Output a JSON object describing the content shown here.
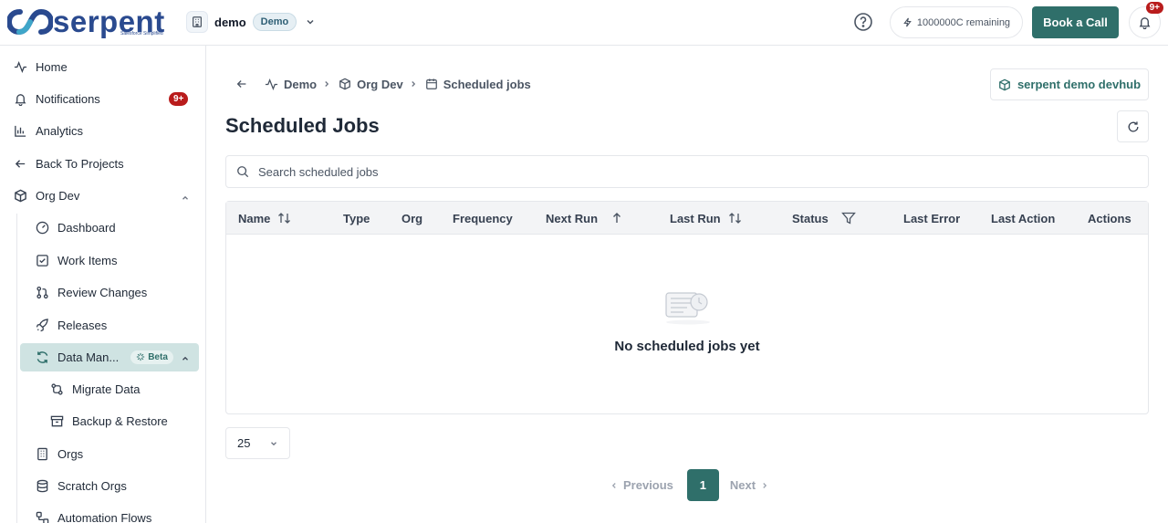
{
  "header": {
    "logo_text": "serpent",
    "logo_tagline": "Salesforce Simplified",
    "workspace_name": "demo",
    "workspace_badge": "Demo",
    "credits_text": "1000000C remaining",
    "book_call_label": "Book a Call",
    "notifications_badge": "9+"
  },
  "sidebar": {
    "home": "Home",
    "notifications": "Notifications",
    "notifications_badge": "9+",
    "analytics": "Analytics",
    "back_to_projects": "Back To Projects",
    "org_dev": "Org Dev",
    "dashboard": "Dashboard",
    "work_items": "Work Items",
    "review_changes": "Review Changes",
    "releases": "Releases",
    "data_management": "Data Man...",
    "beta_badge": "Beta",
    "migrate_data": "Migrate Data",
    "backup_restore": "Backup & Restore",
    "orgs": "Orgs",
    "scratch_orgs": "Scratch Orgs",
    "automation_flows": "Automation Flows"
  },
  "breadcrumb": {
    "demo": "Demo",
    "org_dev": "Org Dev",
    "current": "Scheduled jobs"
  },
  "devhub_label": "serpent demo devhub",
  "page_title": "Scheduled Jobs",
  "search": {
    "placeholder": "Search scheduled jobs"
  },
  "table": {
    "columns": [
      "Name",
      "Type",
      "Org",
      "Frequency",
      "Next Run",
      "Last Run",
      "Status",
      "Last Error",
      "Last Action",
      "Actions"
    ],
    "empty_message": "No scheduled jobs yet"
  },
  "pagination": {
    "page_size": "25",
    "previous": "Previous",
    "current_page": "1",
    "next": "Next"
  },
  "colors": {
    "brand_teal": "#2f6f6a",
    "logo_blue": "#2a4a8f",
    "badge_red": "#b91c1c",
    "active_bg": "#cfe3e2"
  }
}
